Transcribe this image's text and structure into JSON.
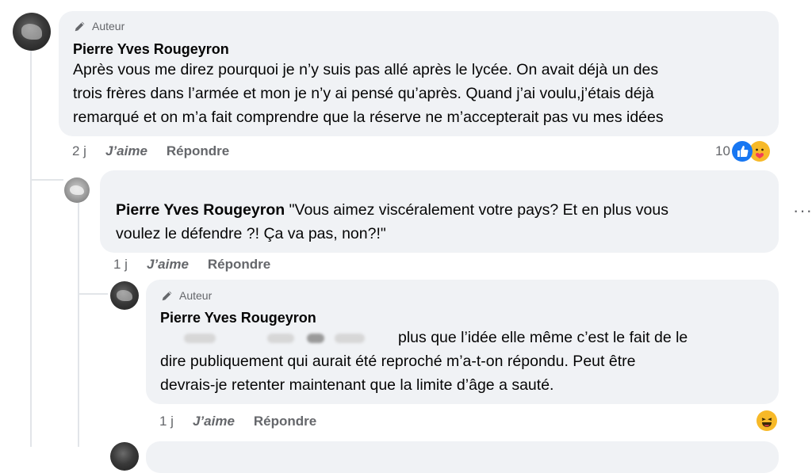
{
  "comments": [
    {
      "author_badge": "Auteur",
      "author": "Pierre Yves Rougeyron",
      "lines": [
        "Après vous me direz pourquoi je n’y suis pas allé après le lycée. On avait déjà un des",
        "trois frères dans l’armée et mon je n’y ai pensé qu’après. Quand j’ai voulu,j’étais déjà",
        "remarqué et on m’a fait comprendre que la réserve ne m’accepterait pas vu mes idées"
      ],
      "time": "2 j",
      "like_label": "J’aime",
      "reply_label": "Répondre",
      "reaction_count": "10",
      "reactions": [
        "like-icon",
        "care-icon"
      ]
    },
    {
      "author": "Pierre Yves Rougeyron",
      "lines": [
        "\"Vous aimez viscéralement votre pays? Et en plus vous",
        "voulez le défendre ?! Ça va pas, non?!\""
      ],
      "time": "1 j",
      "like_label": "J’aime",
      "reply_label": "Répondre",
      "more_label": "···"
    },
    {
      "author_badge": "Auteur",
      "author": "Pierre Yves Rougeyron",
      "lines": [
        "plus que l’idée elle même c’est le fait de le",
        "dire publiquement qui aurait été reproché m’a-t-on répondu. Peut être",
        "devrais-je retenter maintenant que la limite d’âge a sauté."
      ],
      "time": "1 j",
      "like_label": "J’aime",
      "reply_label": "Répondre",
      "reactions": [
        "haha-icon"
      ]
    }
  ],
  "colors": {
    "bubble_bg": "#f0f2f5",
    "meta_text": "#65676b",
    "like_blue": "#1877f2",
    "haha_yellow": "#f7b928",
    "thread_line": "#e2e5e9"
  }
}
